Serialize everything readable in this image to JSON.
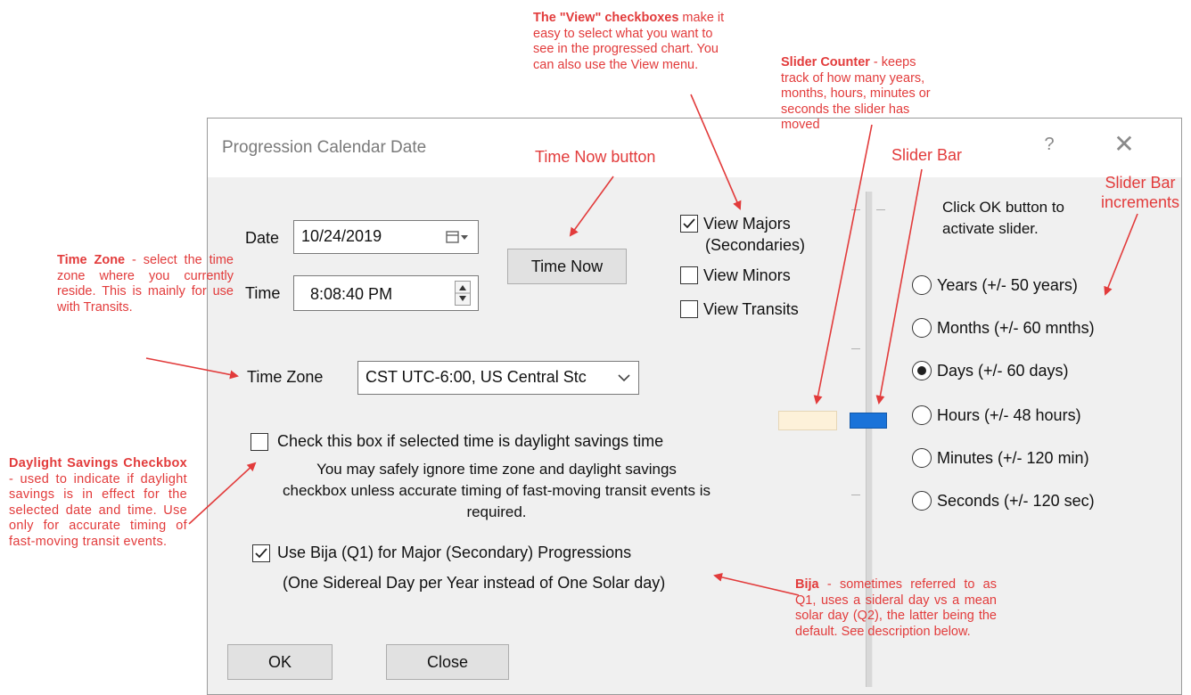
{
  "dialog": {
    "title": "Progression Calendar Date",
    "help": "?",
    "close_glyph": "✕",
    "date_label": "Date",
    "date_value": "10/24/2019",
    "time_label": "Time",
    "time_value": "8:08:40 PM",
    "time_now_label": "Time Now",
    "time_zone_label": "Time Zone",
    "time_zone_value": "CST UTC-6:00, US Central Stc",
    "dst_checkbox_label": "Check this box if selected time is daylight savings time",
    "dst_note": "You may safely ignore time zone and daylight savings checkbox unless accurate timing of fast-moving transit events is required.",
    "bija_label": "Use Bija (Q1) for Major (Secondary) Progressions",
    "bija_sub": "(One Sidereal Day per Year instead of One Solar day)",
    "ok_label": "OK",
    "close_label": "Close",
    "view": {
      "majors_line1": "View Majors",
      "majors_line2": "(Secondaries)",
      "majors_checked": true,
      "minors": "View Minors",
      "minors_checked": false,
      "transits": "View Transits",
      "transits_checked": false
    },
    "slider_hint": "Click OK button to activate slider.",
    "increments": [
      {
        "label": "Years (+/- 50 years)",
        "selected": false
      },
      {
        "label": "Months (+/- 60 mnths)",
        "selected": false
      },
      {
        "label": "Days (+/- 60 days)",
        "selected": true
      },
      {
        "label": "Hours (+/- 48 hours)",
        "selected": false
      },
      {
        "label": "Minutes (+/- 120 min)",
        "selected": false
      },
      {
        "label": "Seconds (+/- 120 sec)",
        "selected": false
      }
    ]
  },
  "annotations": {
    "view_checkboxes_title": "The \"View\" checkboxes",
    "view_checkboxes_text": "make it easy to select what you want to see in the progressed chart. You can also use the View menu.",
    "slider_counter_title": "Slider Counter",
    "slider_counter_text": " - keeps track of how many years, months, hours, minutes or seconds the slider has moved",
    "time_now_button": "Time Now button",
    "slider_bar": "Slider Bar",
    "slider_bar_increments": "Slider Bar increments",
    "time_zone_title": "Time Zone",
    "time_zone_text": " - select the time zone where you currently reside. This is mainly for use with Transits.",
    "daylight_title": "Daylight Savings Checkbox",
    "daylight_text": " - used to indicate if daylight savings is in effect for the selected date and time. Use only for accurate timing of fast-moving transit events.",
    "bija_title": "Bija",
    "bija_text": " - sometimes referred to as Q1, uses a sideral day vs a mean solar day (Q2), the latter being the default. See description below."
  },
  "colors": {
    "annotation": "#e23b3b",
    "slider_thumb": "#1a73d9",
    "slider_counter": "#fdf1d9"
  }
}
